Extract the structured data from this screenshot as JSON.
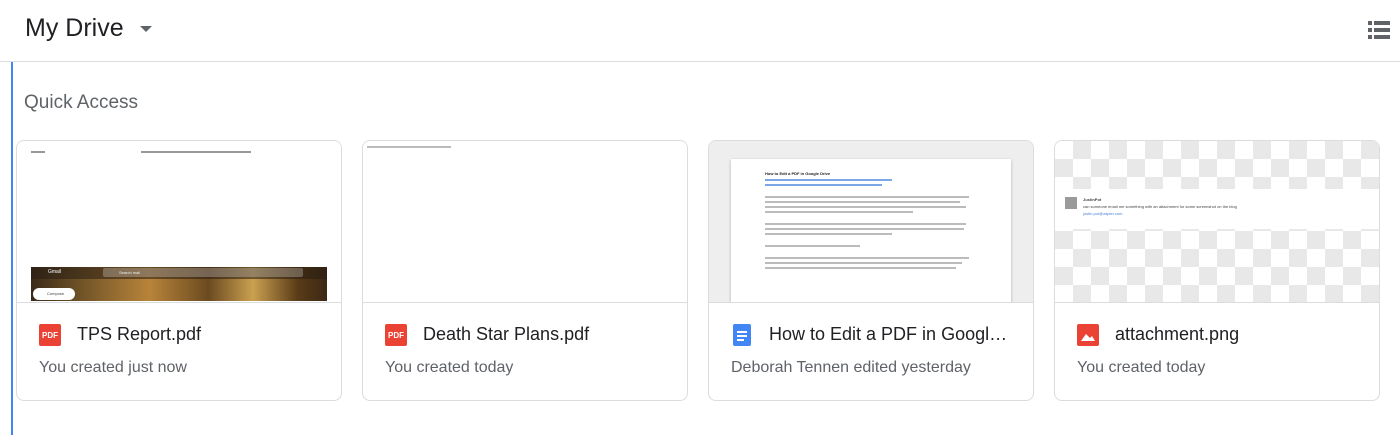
{
  "header": {
    "title": "My Drive"
  },
  "quick_access": {
    "title": "Quick Access",
    "files": [
      {
        "name": "TPS Report.pdf",
        "meta": "You created just now",
        "icon": "pdf-icon"
      },
      {
        "name": "Death Star Plans.pdf",
        "meta": "You created today",
        "icon": "pdf-icon"
      },
      {
        "name": "How to Edit a PDF in Google Drive",
        "meta": "Deborah Tennen edited yesterday",
        "icon": "google-docs-icon"
      },
      {
        "name": "attachment.png",
        "meta": "You created today",
        "icon": "image-icon"
      }
    ]
  },
  "thumbnails": {
    "tps": {
      "gmail_label": "Gmail",
      "search_placeholder": "Search mail",
      "compose": "Compose"
    },
    "doc": {
      "heading": "How to Edit a PDF in Google Drive"
    },
    "png": {
      "author": "JustinPot",
      "message": "can someone email me something with an attachment for some screenshot on the blog",
      "email": "justin.pot@zapier.com"
    }
  },
  "colors": {
    "pdf": "#ea4335",
    "docs": "#4285f4",
    "image": "#ea4335",
    "accent_line": "#4285f4"
  }
}
